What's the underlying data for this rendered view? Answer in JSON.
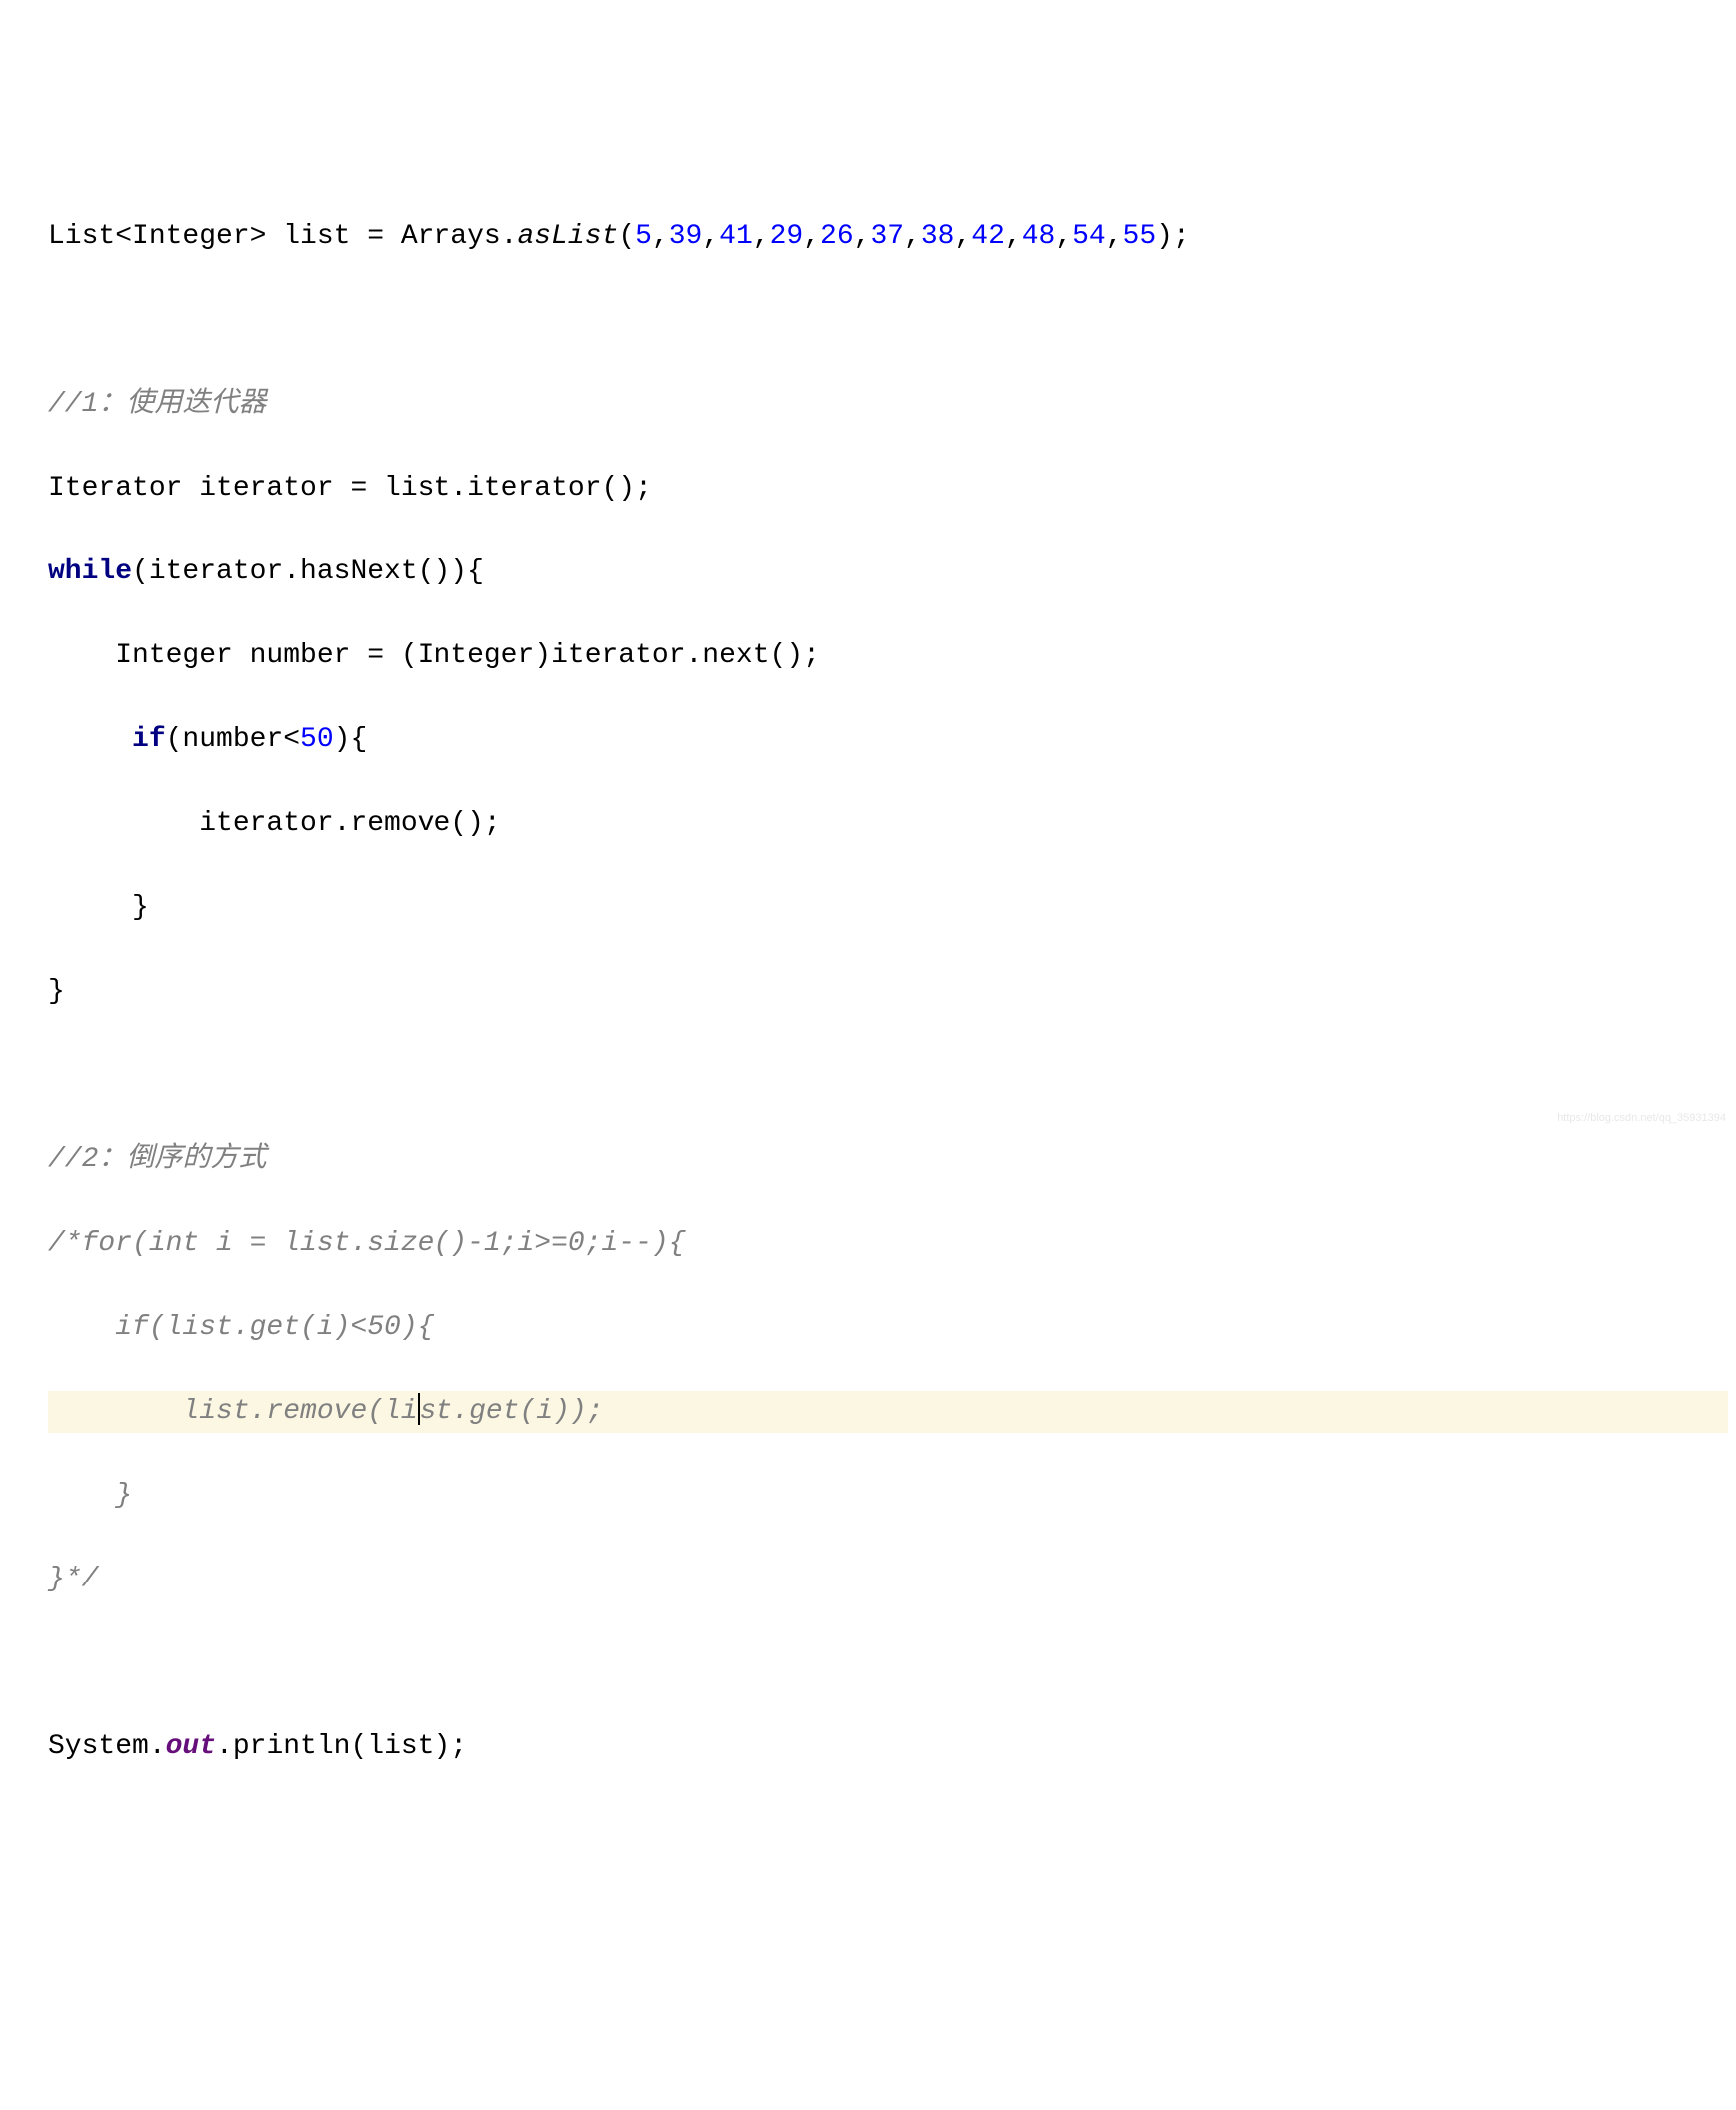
{
  "code": {
    "line1": {
      "part1": "List<Integer> list = Arrays.",
      "method": "asList",
      "part2": "(",
      "n1": "5",
      "c1": ",",
      "n2": "39",
      "c2": ",",
      "n3": "41",
      "c3": ",",
      "n4": "29",
      "c4": ",",
      "n5": "26",
      "c5": ",",
      "n6": "37",
      "c6": ",",
      "n7": "38",
      "c7": ",",
      "n8": "42",
      "c8": ",",
      "n9": "48",
      "c9": ",",
      "n10": "54",
      "c10": ",",
      "n11": "55",
      "part3": ");"
    },
    "line3": "//1：使用迭代器",
    "line4": "Iterator iterator = list.iterator();",
    "line5": {
      "kw": "while",
      "rest": "(iterator.hasNext()){"
    },
    "line6": "    Integer number = (Integer)iterator.next();",
    "line7": {
      "indent": "     ",
      "kw": "if",
      "part1": "(number<",
      "num": "50",
      "part2": "){"
    },
    "line8": "         iterator.remove();",
    "line9": "     }",
    "line10": "}",
    "line12": "//2：倒序的方式",
    "line13": "/*for(int i = list.size()-1;i>=0;i--){",
    "line14": "    if(list.get(i)<50){",
    "line15a": "        list.remove(li",
    "line15b": "st.get(i));",
    "line16": "    }",
    "line17": "}*/",
    "line19": {
      "part1": "System.",
      "field": "out",
      "part2": ".println(list);"
    }
  },
  "watermark": "https://blog.csdn.net/qq_35931394"
}
